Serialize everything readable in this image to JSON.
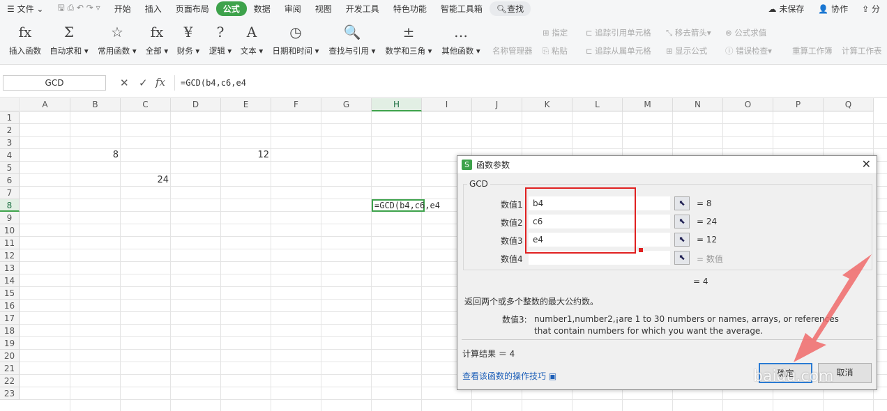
{
  "menu": {
    "file": "文件",
    "tabs": [
      "开始",
      "插入",
      "页面布局",
      "公式",
      "数据",
      "审阅",
      "视图",
      "开发工具",
      "特色功能",
      "智能工具箱"
    ],
    "active_tab": "公式",
    "search": "查找",
    "unsaved": "未保存",
    "collab": "协作",
    "share": "分"
  },
  "ribbon": {
    "groups": [
      {
        "icon": "fx",
        "label": "插入函数"
      },
      {
        "icon": "Σ",
        "label": "自动求和"
      },
      {
        "icon": "☆",
        "label": "常用函数"
      },
      {
        "icon": "fx",
        "label": "全部"
      },
      {
        "icon": "¥",
        "label": "财务"
      },
      {
        "icon": "?",
        "label": "逻辑"
      },
      {
        "icon": "A",
        "label": "文本"
      },
      {
        "icon": "◷",
        "label": "日期和时间"
      },
      {
        "icon": "🔍",
        "label": "查找与引用"
      },
      {
        "icon": "±",
        "label": "数学和三角"
      },
      {
        "icon": "…",
        "label": "其他函数"
      }
    ],
    "disabled": {
      "name_manager": "名称管理器",
      "specify": "指定",
      "paste": "粘贴",
      "trace_precedents": "追踪引用单元格",
      "trace_dependents": "追踪从属单元格",
      "remove_arrows": "移去箭头",
      "show_formulas": "显示公式",
      "evaluate": "公式求值",
      "error_check": "错误检查",
      "recalc_book": "重算工作簿",
      "calc_sheet": "计算工作表"
    }
  },
  "formula_bar": {
    "name_box": "GCD",
    "formula": "=GCD(b4,c6,e4"
  },
  "sheet": {
    "columns": [
      "A",
      "B",
      "C",
      "D",
      "E",
      "F",
      "G",
      "H",
      "I",
      "J",
      "K",
      "L",
      "M",
      "N",
      "O",
      "P",
      "Q"
    ],
    "rows": 23,
    "selected_col": "H",
    "selected_row": 8,
    "cells": [
      {
        "col": 1,
        "row": 4,
        "value": "8",
        "align": "right"
      },
      {
        "col": 4,
        "row": 4,
        "value": "12",
        "align": "right"
      },
      {
        "col": 2,
        "row": 6,
        "value": "24",
        "align": "right"
      },
      {
        "col": 7,
        "row": 8,
        "value": "=GCD(b4,c6,e4",
        "align": "left"
      }
    ]
  },
  "dialog": {
    "title": "函数参数",
    "func": "GCD",
    "args": [
      {
        "label": "数值1",
        "value": "b4",
        "result": "= 8"
      },
      {
        "label": "数值2",
        "value": "c6",
        "result": "= 24"
      },
      {
        "label": "数值3",
        "value": "e4",
        "result": "= 12"
      },
      {
        "label": "数值4",
        "value": "",
        "result": "= 数值"
      }
    ],
    "result_line": "= 4",
    "description": "返回两个或多个整数的最大公约数。",
    "arg_label": "数值3:",
    "arg_help": "number1,number2,¡are 1 to 30 numbers or names, arrays, or references that contain numbers for which you want the average.",
    "calc_result": "计算结果 ＝ 4",
    "tips_link": "查看该函数的操作技巧",
    "ok": "确定",
    "cancel": "取消"
  },
  "watermark": "baidu.com"
}
